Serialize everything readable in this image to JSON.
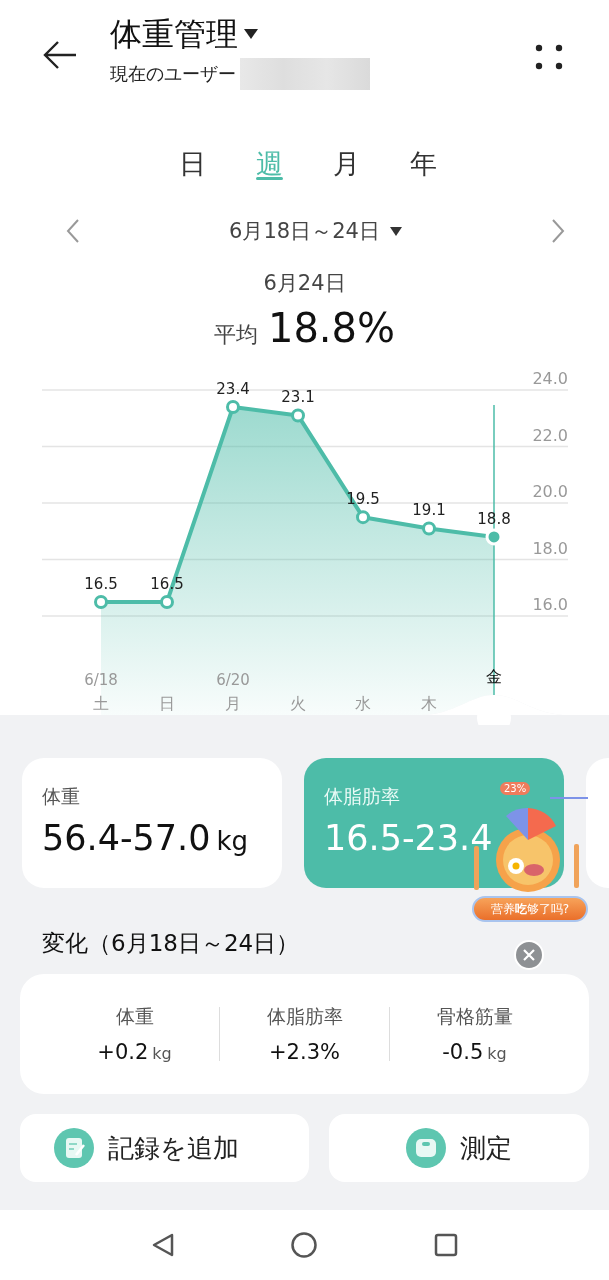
{
  "header": {
    "title": "体重管理",
    "subtitle": "現在のユーザー"
  },
  "period_tabs": [
    {
      "label": "日",
      "selected": false
    },
    {
      "label": "週",
      "selected": true
    },
    {
      "label": "月",
      "selected": false
    },
    {
      "label": "年",
      "selected": false
    }
  ],
  "date_range": "6月18日～24日",
  "selected_date": "6月24日",
  "average": {
    "label": "平均",
    "value": "18.8%"
  },
  "chart_cursor": {
    "on_latest": true
  },
  "chart_data": {
    "type": "area",
    "categories": [
      "土",
      "日",
      "月",
      "火",
      "水",
      "木",
      "金"
    ],
    "series": [
      {
        "color": "#4dbca8",
        "values": [
          16.5,
          16.5,
          23.4,
          23.1,
          19.5,
          19.1,
          18.8
        ]
      }
    ],
    "ylim": [
      12.5,
      24.0
    ],
    "grid": true,
    "yticks": [
      {
        "value": 16,
        "label": "16.0"
      },
      {
        "value": 18,
        "label": "18.0"
      },
      {
        "value": 20,
        "label": "20.0"
      },
      {
        "value": 22,
        "label": "22.0"
      },
      {
        "value": 24,
        "label": "24.0"
      }
    ],
    "data_labels": true,
    "annotations": [
      "6/18",
      "6/20"
    ]
  },
  "metric_cards": [
    {
      "label": "体重",
      "value": "56.4-57.0",
      "unit": "kg",
      "selected": false
    },
    {
      "label": "体脂肪率",
      "value": "16.5-23.4",
      "selected": true
    }
  ],
  "promo": {
    "badge": "23%",
    "text": "营养**吃**够了吗?"
  },
  "change": {
    "title": "変化（6月18日～24日）",
    "items": [
      {
        "label": "体重",
        "value": "+0.2",
        "unit": "kg"
      },
      {
        "label": "体脂肪率",
        "value": "+2.3%"
      },
      {
        "label": "骨格筋量",
        "value": "-0.5",
        "unit": "kg"
      }
    ]
  },
  "actions": [
    {
      "kind": "record",
      "label": "記録を追加"
    },
    {
      "kind": "measure",
      "label": "測定"
    }
  ]
}
